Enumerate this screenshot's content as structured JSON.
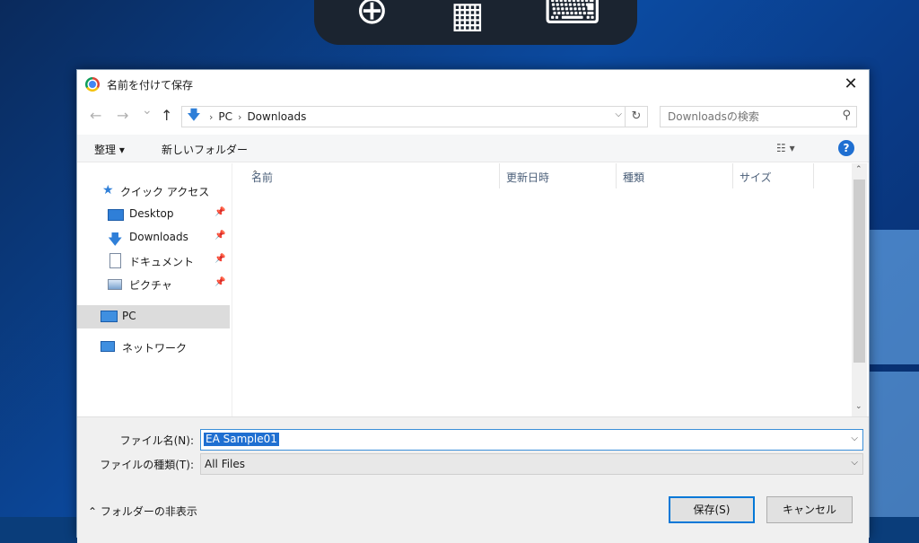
{
  "dialog": {
    "title": "名前を付けて保存",
    "close_glyph": "✕"
  },
  "nav": {
    "back": "←",
    "forward": "→",
    "recent": "⌄",
    "up": "↑"
  },
  "address": {
    "segments": [
      "PC",
      "Downloads"
    ],
    "separator": "›",
    "refresh_glyph": "↻"
  },
  "search": {
    "placeholder": "Downloadsの検索"
  },
  "commands": {
    "organize": "整理 ▾",
    "new_folder": "新しいフォルダー",
    "view": "☷ ▾",
    "help": "?"
  },
  "sidebar": {
    "quick_access": "クイック アクセス",
    "items": [
      {
        "label": "Desktop",
        "icon": "desktop-icon"
      },
      {
        "label": "Downloads",
        "icon": "download-icon"
      },
      {
        "label": "ドキュメント",
        "icon": "document-icon"
      },
      {
        "label": "ピクチャ",
        "icon": "picture-icon"
      }
    ],
    "pc": "PC",
    "network": "ネットワーク",
    "pin_glyph": "📌"
  },
  "columns": [
    "名前",
    "更新日時",
    "種類",
    "サイズ"
  ],
  "form": {
    "filename_label": "ファイル名(N):",
    "filename_value": "EA Sample01",
    "filetype_label": "ファイルの種類(T):",
    "filetype_value": "All Files",
    "hide_folders": "⌃  フォルダーの非表示",
    "save": "保存(S)",
    "cancel": "キャンセル"
  },
  "toolbar_overlay": {
    "zoom": "⊕",
    "layout": "▦",
    "keyboard": "⌨"
  },
  "colors": {
    "accent": "#1f6fd1",
    "desktop": "#0a3d7a"
  }
}
